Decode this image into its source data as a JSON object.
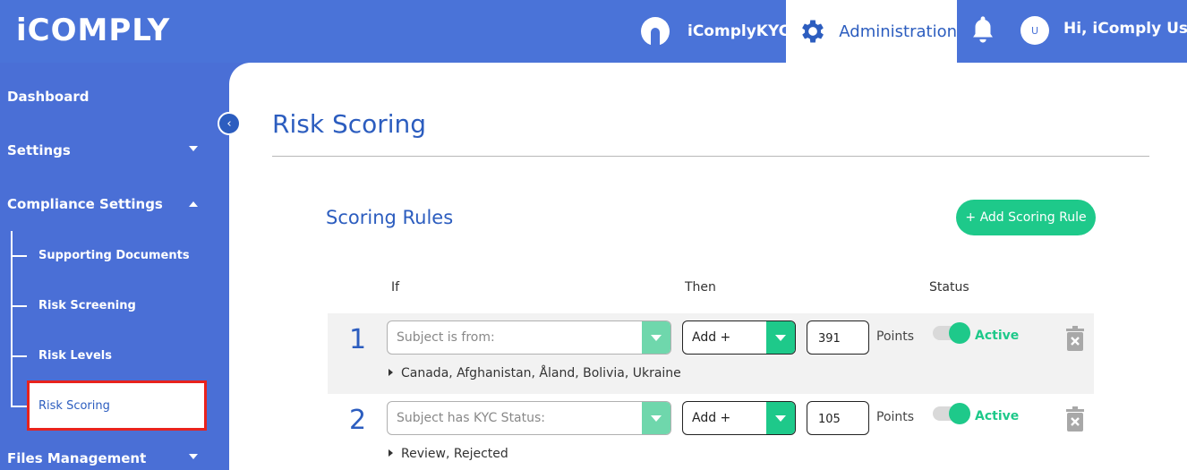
{
  "brand": {
    "logo_text": "iCOMPLY"
  },
  "header": {
    "kyc_label": "iComplyKYC",
    "admin_label": "Administration",
    "avatar_initial": "U",
    "greeting": "Hi, iComply User"
  },
  "sidebar": {
    "items": [
      {
        "label": "Dashboard"
      },
      {
        "label": "Settings"
      },
      {
        "label": "Compliance Settings"
      },
      {
        "label": "Files Management"
      }
    ],
    "sub_items": [
      {
        "label": "Supporting Documents"
      },
      {
        "label": "Risk Screening"
      },
      {
        "label": "Risk Levels"
      },
      {
        "label": "Risk Scoring"
      }
    ],
    "collapse_glyph": "‹"
  },
  "main": {
    "title": "Risk Scoring",
    "section_title": "Scoring Rules",
    "add_button": "+ Add Scoring Rule",
    "columns": {
      "if": "If",
      "then": "Then",
      "status": "Status"
    },
    "rules": [
      {
        "number": "1",
        "condition_placeholder": "Subject is from:",
        "operator": "Add +",
        "points": "391",
        "points_label": "Points",
        "status": "Active",
        "summary": "Canada, Afghanistan, Åland, Bolivia, Ukraine"
      },
      {
        "number": "2",
        "condition_placeholder": "Subject has KYC Status:",
        "operator": "Add +",
        "points": "105",
        "points_label": "Points",
        "status": "Active",
        "summary": "Review, Rejected"
      }
    ]
  },
  "colors": {
    "brand_blue": "#4a73d8",
    "accent_blue": "#2c5dbf",
    "green": "#1ec98a",
    "highlight_red": "#e8231d"
  }
}
